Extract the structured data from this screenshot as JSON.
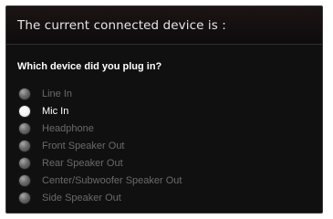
{
  "header": {
    "title": "The current connected device is :"
  },
  "question": "Which device did you plug in?",
  "options": [
    {
      "label": "Line In",
      "checked": false
    },
    {
      "label": "Mic In",
      "checked": true
    },
    {
      "label": "Headphone",
      "checked": false
    },
    {
      "label": "Front Speaker Out",
      "checked": false
    },
    {
      "label": "Rear Speaker Out",
      "checked": false
    },
    {
      "label": "Center/Subwoofer Speaker Out",
      "checked": false
    },
    {
      "label": "Side Speaker Out",
      "checked": false
    }
  ],
  "colors": {
    "background": "#101010",
    "text_active": "#ffffff",
    "text_inactive": "#6a6a6a"
  }
}
